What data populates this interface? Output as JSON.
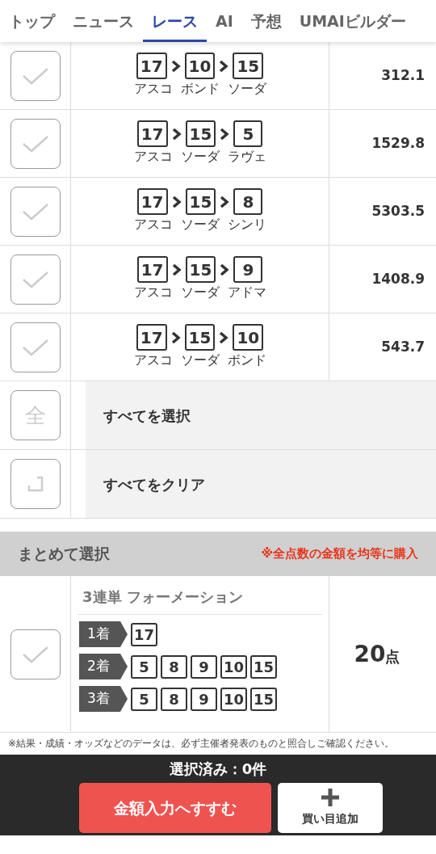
{
  "nav": {
    "tabs": [
      {
        "label": "トップ",
        "selected": false
      },
      {
        "label": "ニュース",
        "selected": false
      },
      {
        "label": "レース",
        "selected": true
      },
      {
        "label": "AI",
        "selected": false
      },
      {
        "label": "予想",
        "selected": false
      },
      {
        "label": "UMAIビルダー",
        "selected": false
      }
    ]
  },
  "combos": [
    {
      "checked": false,
      "horses": [
        {
          "number": "17",
          "name": "アスコ"
        },
        {
          "number": "10",
          "name": "ボンド"
        },
        {
          "number": "15",
          "name": "ソーダ"
        }
      ],
      "odds": "312.1"
    },
    {
      "checked": false,
      "horses": [
        {
          "number": "17",
          "name": "アスコ"
        },
        {
          "number": "15",
          "name": "ソーダ"
        },
        {
          "number": "5",
          "name": "ラヴェ"
        }
      ],
      "odds": "1529.8"
    },
    {
      "checked": false,
      "horses": [
        {
          "number": "17",
          "name": "アスコ"
        },
        {
          "number": "15",
          "name": "ソーダ"
        },
        {
          "number": "8",
          "name": "シンリ"
        }
      ],
      "odds": "5303.5"
    },
    {
      "checked": false,
      "horses": [
        {
          "number": "17",
          "name": "アスコ"
        },
        {
          "number": "15",
          "name": "ソーダ"
        },
        {
          "number": "9",
          "name": "アドマ"
        }
      ],
      "odds": "1408.9"
    },
    {
      "checked": false,
      "horses": [
        {
          "number": "17",
          "name": "アスコ"
        },
        {
          "number": "15",
          "name": "ソーダ"
        },
        {
          "number": "10",
          "name": "ボンド"
        }
      ],
      "odds": "543.7"
    }
  ],
  "bulk_actions": [
    {
      "kind": "select_all",
      "checked": false,
      "icon_text": "全",
      "label": "すべてを選択"
    },
    {
      "kind": "clear",
      "checked": false,
      "label": "すべてをクリア"
    }
  ],
  "summary_section": {
    "title": "まとめて選択",
    "note": "※全点数の金額を均等に購入"
  },
  "formation": {
    "checked": false,
    "title": "3連単 フォーメーション",
    "positions": [
      {
        "label": "1着",
        "numbers": [
          "17"
        ]
      },
      {
        "label": "2着",
        "numbers": [
          "5",
          "8",
          "9",
          "10",
          "15"
        ]
      },
      {
        "label": "3着",
        "numbers": [
          "5",
          "8",
          "9",
          "10",
          "15"
        ]
      }
    ],
    "count": "20",
    "unit": "点"
  },
  "disclaimer": "※結果・成績・オッズなどのデータは、必ず主催者発表のものと照合しご確認ください。",
  "bottom_bar": {
    "selected_count": "選択済み：0件",
    "primary_button": "金額入力へすすむ",
    "add_button": "買い目追加"
  }
}
